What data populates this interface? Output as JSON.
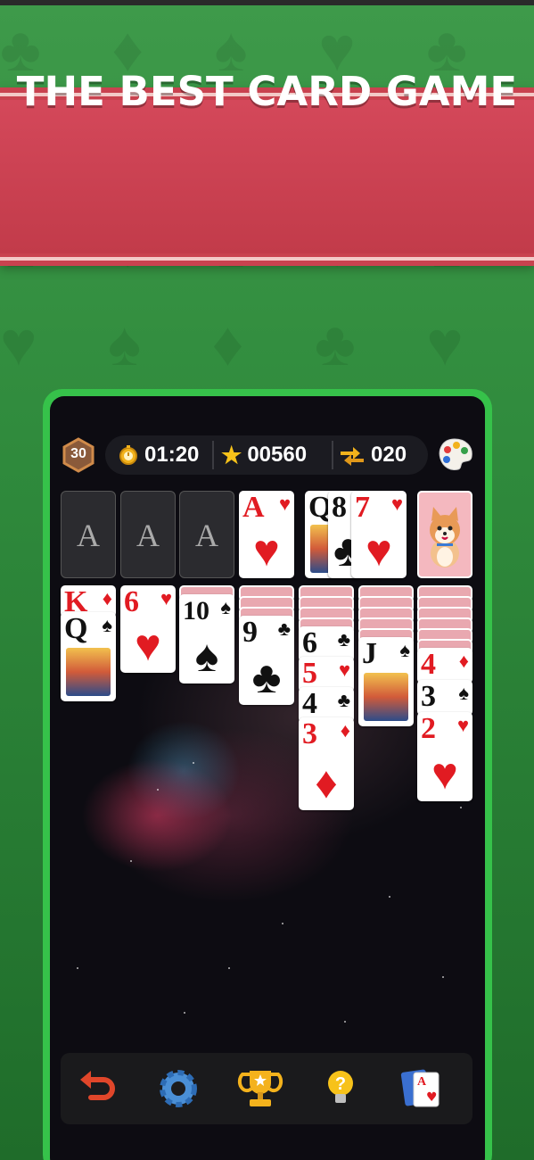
{
  "banner": {
    "title": "THE BEST CARD GAME"
  },
  "hud": {
    "level": "30",
    "timer": "01:20",
    "score": "00560",
    "moves": "020",
    "icons": [
      "stopwatch-icon",
      "star-icon",
      "swap-arrows-icon",
      "palette-icon"
    ]
  },
  "foundations": [
    {
      "label": "A"
    },
    {
      "label": "A"
    },
    {
      "label": "A"
    },
    {
      "rank": "A",
      "suit": "♥",
      "color": "red"
    }
  ],
  "waste": [
    {
      "rank": "Q",
      "suit": "♠",
      "color": "black"
    },
    {
      "rank": "8",
      "suit": "♣",
      "color": "black"
    },
    {
      "rank": "7",
      "suit": "♥",
      "color": "red"
    }
  ],
  "tableau": {
    "col1": [
      {
        "rank": "K",
        "suit": "♦",
        "color": "red"
      },
      {
        "rank": "Q",
        "suit": "♠",
        "color": "black"
      }
    ],
    "col2": [
      {
        "rank": "6",
        "suit": "♥",
        "color": "red"
      }
    ],
    "col3": [
      {
        "rank": "10",
        "suit": "♠",
        "color": "black"
      }
    ],
    "col4": [
      {
        "rank": "9",
        "suit": "♣",
        "color": "black"
      }
    ],
    "col5": [
      {
        "rank": "6",
        "suit": "♣",
        "color": "black"
      },
      {
        "rank": "5",
        "suit": "♥",
        "color": "red"
      },
      {
        "rank": "4",
        "suit": "♣",
        "color": "black"
      },
      {
        "rank": "3",
        "suit": "♦",
        "color": "red"
      }
    ],
    "col6": [
      {
        "rank": "J",
        "suit": "♠",
        "color": "black"
      }
    ],
    "col7": [
      {
        "rank": "4",
        "suit": "♦",
        "color": "red"
      },
      {
        "rank": "3",
        "suit": "♠",
        "color": "black"
      },
      {
        "rank": "2",
        "suit": "♥",
        "color": "red"
      }
    ]
  },
  "toolbar": [
    "undo-icon",
    "settings-gear-icon",
    "trophy-icon",
    "hint-bulb-icon",
    "deck-cards-icon"
  ],
  "colors": {
    "background": "#2f8a3c",
    "banner": "#c9424f",
    "frame": "#36c24a",
    "card_red": "#e11b22"
  }
}
